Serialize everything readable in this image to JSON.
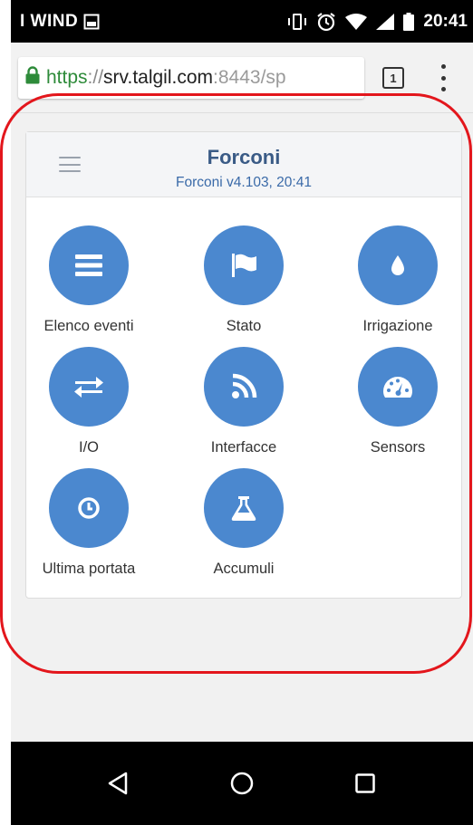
{
  "status_bar": {
    "carrier": "I WIND",
    "time": "20:41"
  },
  "browser": {
    "url_scheme": "https",
    "url_separator": "://",
    "url_host": "srv.talgil.com",
    "url_rest": ":8443/sp",
    "tab_count": "1"
  },
  "app": {
    "title": "Forconi",
    "subtitle": "Forconi v4.103, 20:41"
  },
  "tiles": [
    {
      "label": "Elenco eventi",
      "icon": "list-icon"
    },
    {
      "label": "Stato",
      "icon": "flag-icon"
    },
    {
      "label": "Irrigazione",
      "icon": "water-drop-icon"
    },
    {
      "label": "I/O",
      "icon": "exchange-arrows-icon"
    },
    {
      "label": "Interfacce",
      "icon": "rss-feed-icon"
    },
    {
      "label": "Sensors",
      "icon": "gauge-icon"
    },
    {
      "label": "Ultima portata",
      "icon": "clock-icon"
    },
    {
      "label": "Accumuli",
      "icon": "flask-icon"
    }
  ],
  "colors": {
    "tile_blue": "#4b88cf",
    "title_blue": "#3a5b86",
    "annotation_red": "#e3161c",
    "url_green": "#2e8b3a"
  }
}
